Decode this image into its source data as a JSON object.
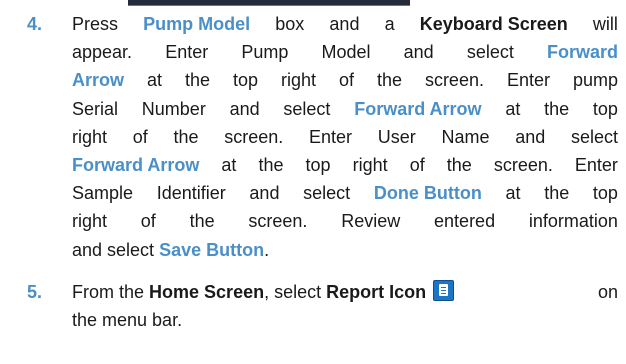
{
  "steps": [
    {
      "number": "4.",
      "lines": [
        [
          "Press",
          "Pump Model",
          "box",
          "and",
          "a",
          "Keyboard Screen",
          "will"
        ],
        [
          "appear.",
          "Enter",
          "Pump",
          "Model",
          "and",
          "select",
          "Forward"
        ],
        [
          "Arrow",
          "at",
          "the",
          "top",
          "right",
          "of",
          "the",
          "screen.",
          "Enter",
          "pump"
        ],
        [
          "Serial",
          "Number",
          "and",
          "select",
          "Forward Arrow",
          "at",
          "the",
          "top"
        ],
        [
          "right",
          "of",
          "the",
          "screen.",
          "Enter",
          "User",
          "Name",
          "and",
          "select"
        ],
        [
          "Forward Arrow",
          "at",
          "the",
          "top",
          "right",
          "of",
          "the",
          "screen.",
          "Enter"
        ],
        [
          "Sample",
          "Identifier",
          "and",
          "select",
          "Done Button",
          "at",
          "the",
          "top"
        ],
        [
          "right",
          "of",
          "the",
          "screen.",
          "Review",
          "entered",
          "information"
        ],
        [
          "and select ",
          "Save Button",
          "."
        ]
      ]
    },
    {
      "number": "5.",
      "lines": [
        [
          "From the ",
          "Home Screen",
          ", select ",
          "Report Icon",
          "on"
        ],
        [
          "the menu bar."
        ]
      ]
    }
  ],
  "icons": {
    "report_icon": "report-icon"
  }
}
